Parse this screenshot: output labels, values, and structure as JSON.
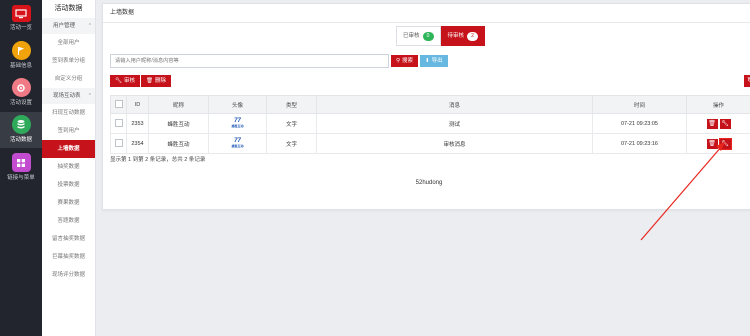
{
  "rail": [
    {
      "label": "活动一览",
      "icon": "monitor-icon",
      "color": "#d7141a",
      "active": false
    },
    {
      "label": "基础信息",
      "icon": "flag-icon",
      "color": "#f0a30a",
      "active": false
    },
    {
      "label": "活动设置",
      "icon": "gear-icon",
      "color": "#f07b86",
      "active": false
    },
    {
      "label": "活动数据",
      "icon": "database-icon",
      "color": "#2eaa5a",
      "active": true
    },
    {
      "label": "链接与菜单",
      "icon": "grid-icon",
      "color": "#c34bcf",
      "active": false
    }
  ],
  "subnav": {
    "title": "活动数据",
    "group1": "用户管理",
    "items1": [
      "全部用户",
      "签到表单分组",
      "自定义分组"
    ],
    "group2": "现场互动表",
    "items2": [
      "扫现互动数据",
      "签到用户",
      "上墙数据",
      "抽奖数据",
      "投票数据",
      "赛果数据",
      "答题数据",
      "留言抽奖数据",
      "巨幕抽奖数据",
      "现场评分数据"
    ]
  },
  "card": {
    "title": "上墙数据"
  },
  "tabs": [
    {
      "label": "已审核",
      "count": "0",
      "active": false
    },
    {
      "label": "待审核",
      "count": "2",
      "active": true
    }
  ],
  "search": {
    "placeholder": "请输入用户昵称/消息内容等",
    "search_label": "搜索",
    "export_label": "导出"
  },
  "actions": {
    "audit_label": "审核",
    "delete_label": "删除"
  },
  "table": {
    "headers": [
      "ID",
      "昵称",
      "头像",
      "类型",
      "消息",
      "时间",
      "操作"
    ],
    "rows": [
      {
        "id": "2353",
        "nick": "蜂胜互动",
        "type": "文字",
        "msg": "测试",
        "time": "07-21 09:23:05"
      },
      {
        "id": "2354",
        "nick": "蜂胜互动",
        "type": "文字",
        "msg": "审核消息",
        "time": "07-21 09:23:16"
      }
    ]
  },
  "avatar_logo": {
    "main": "77",
    "sub": "蜂胜互动"
  },
  "pager": "显示第 1 到第 2 条记录，总共 2 条记录",
  "footer": "52hudong",
  "colors": {
    "accent": "#c5121b",
    "rail": "#22252d",
    "annotation_arrow": "#e8261e"
  }
}
